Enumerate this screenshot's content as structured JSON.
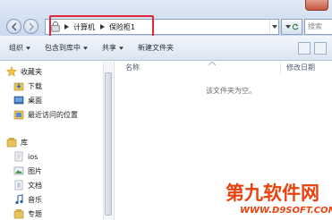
{
  "breadcrumb": [
    "计算机",
    "保险柜1"
  ],
  "search": {
    "placeholder": "搜索"
  },
  "toolbar": {
    "organize": "组织",
    "include_in_library": "包含到库中",
    "share": "共享",
    "new_folder": "新建文件夹"
  },
  "columns": {
    "name": "名称",
    "date_modified": "修改日期"
  },
  "empty_message": "该文件夹为空。",
  "favorites": {
    "header": "收藏夹",
    "items": [
      "下载",
      "桌面",
      "最近访问的位置"
    ]
  },
  "libraries": {
    "header": "库",
    "items": [
      "ios",
      "图片",
      "文档",
      "音乐",
      "专题"
    ]
  },
  "watermark": {
    "main": "第九软件网",
    "sub": "WWW.D9SOFT.COM"
  },
  "colors": {
    "highlight": "#e0263a",
    "watermark": "#e8420f",
    "folder": "#e8c25b"
  }
}
